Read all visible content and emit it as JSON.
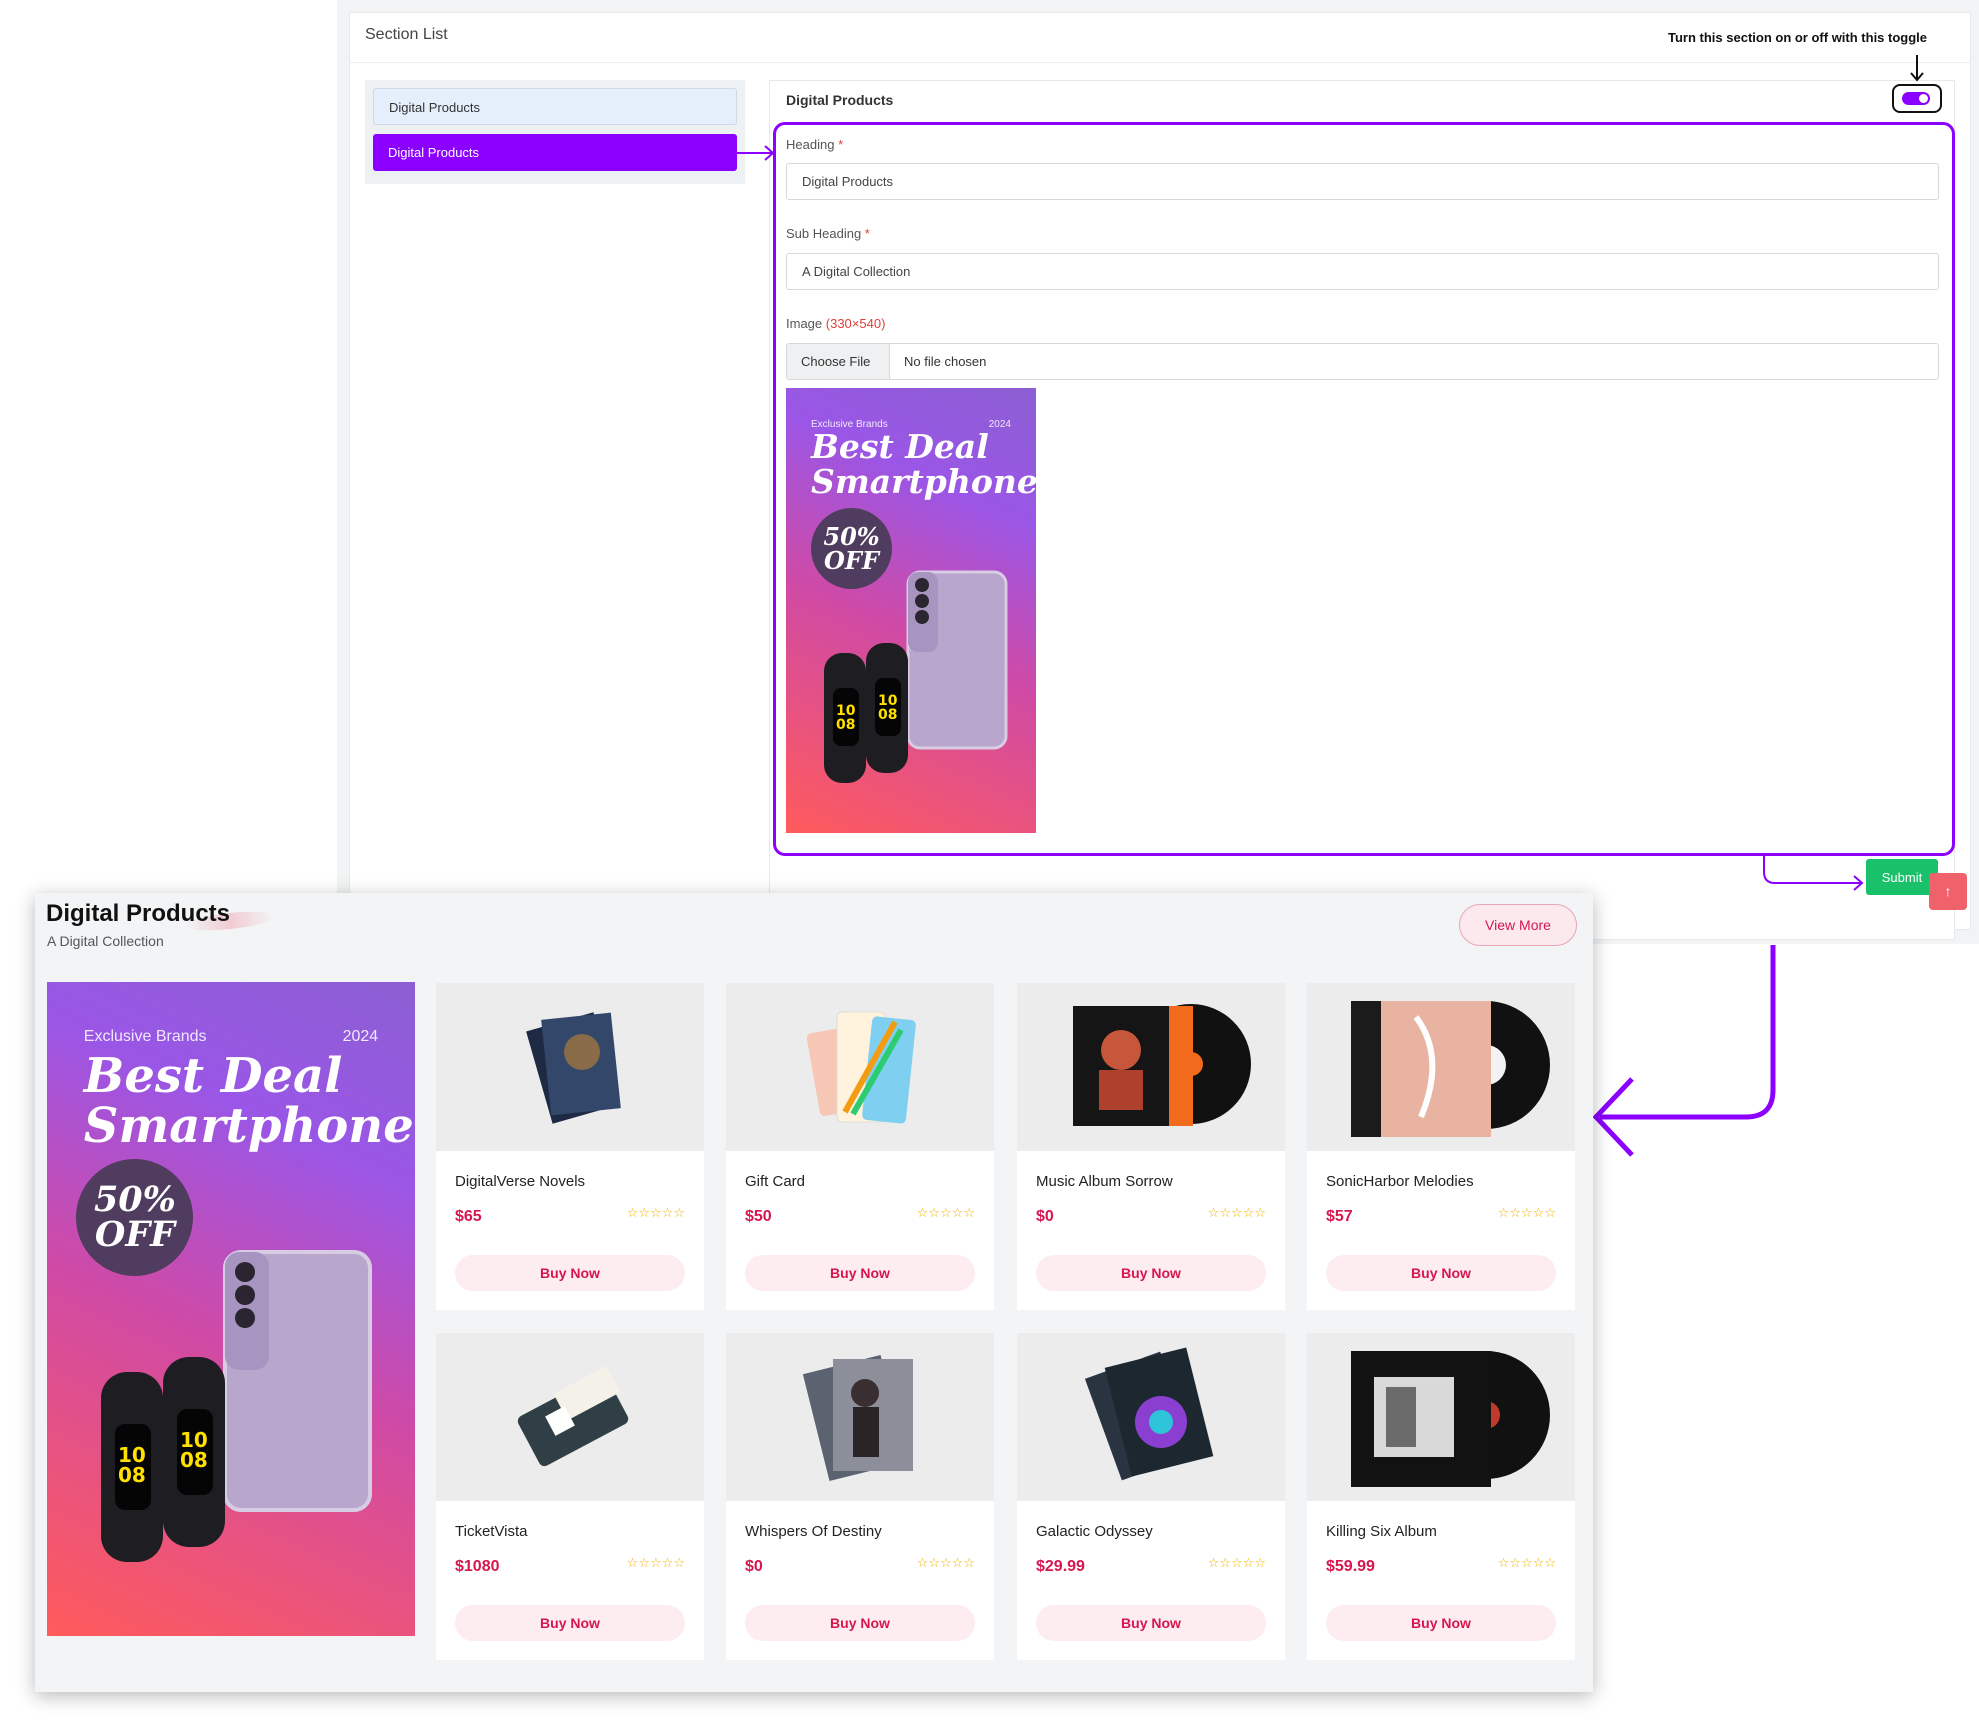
{
  "admin": {
    "card_title": "Section List",
    "section_list": [
      "Digital Products",
      "Digital Products"
    ],
    "form": {
      "panel_title": "Digital Products",
      "toggle_on": true,
      "heading_label": "Heading",
      "heading_value": "Digital Products",
      "subheading_label": "Sub Heading",
      "subheading_value": "A Digital Collection",
      "image_label": "Image",
      "image_size": "(330×540)",
      "choose_file": "Choose File",
      "file_status": "No file chosen",
      "required_mark": "*",
      "submit": "Submit",
      "scroll_top_icon": "arrow-up-icon"
    },
    "hint": "Turn this section on or off with this toggle"
  },
  "banner": {
    "brand": "Exclusive Brands",
    "year": "2024",
    "line1": "Best Deal",
    "line2": "Smartphone",
    "badge_pct": "50%",
    "badge_off": "OFF"
  },
  "store": {
    "title": "Digital Products",
    "subtitle": "A Digital Collection",
    "view_more": "View More",
    "buy_label": "Buy Now",
    "stars": "☆☆☆☆☆",
    "products": [
      {
        "name": "DigitalVerse Novels",
        "price": "$65"
      },
      {
        "name": "Gift Card",
        "price": "$50"
      },
      {
        "name": "Music Album Sorrow",
        "price": "$0"
      },
      {
        "name": "SonicHarbor Melodies",
        "price": "$57"
      },
      {
        "name": "TicketVista",
        "price": "$1080"
      },
      {
        "name": "Whispers Of Destiny",
        "price": "$0"
      },
      {
        "name": "Galactic Odyssey",
        "price": "$29.99"
      },
      {
        "name": "Killing Six Album",
        "price": "$59.99"
      }
    ]
  },
  "colors": {
    "accent": "#8b00ff",
    "price": "#d6174e",
    "submit": "#19c16b",
    "star": "#f0b400"
  }
}
